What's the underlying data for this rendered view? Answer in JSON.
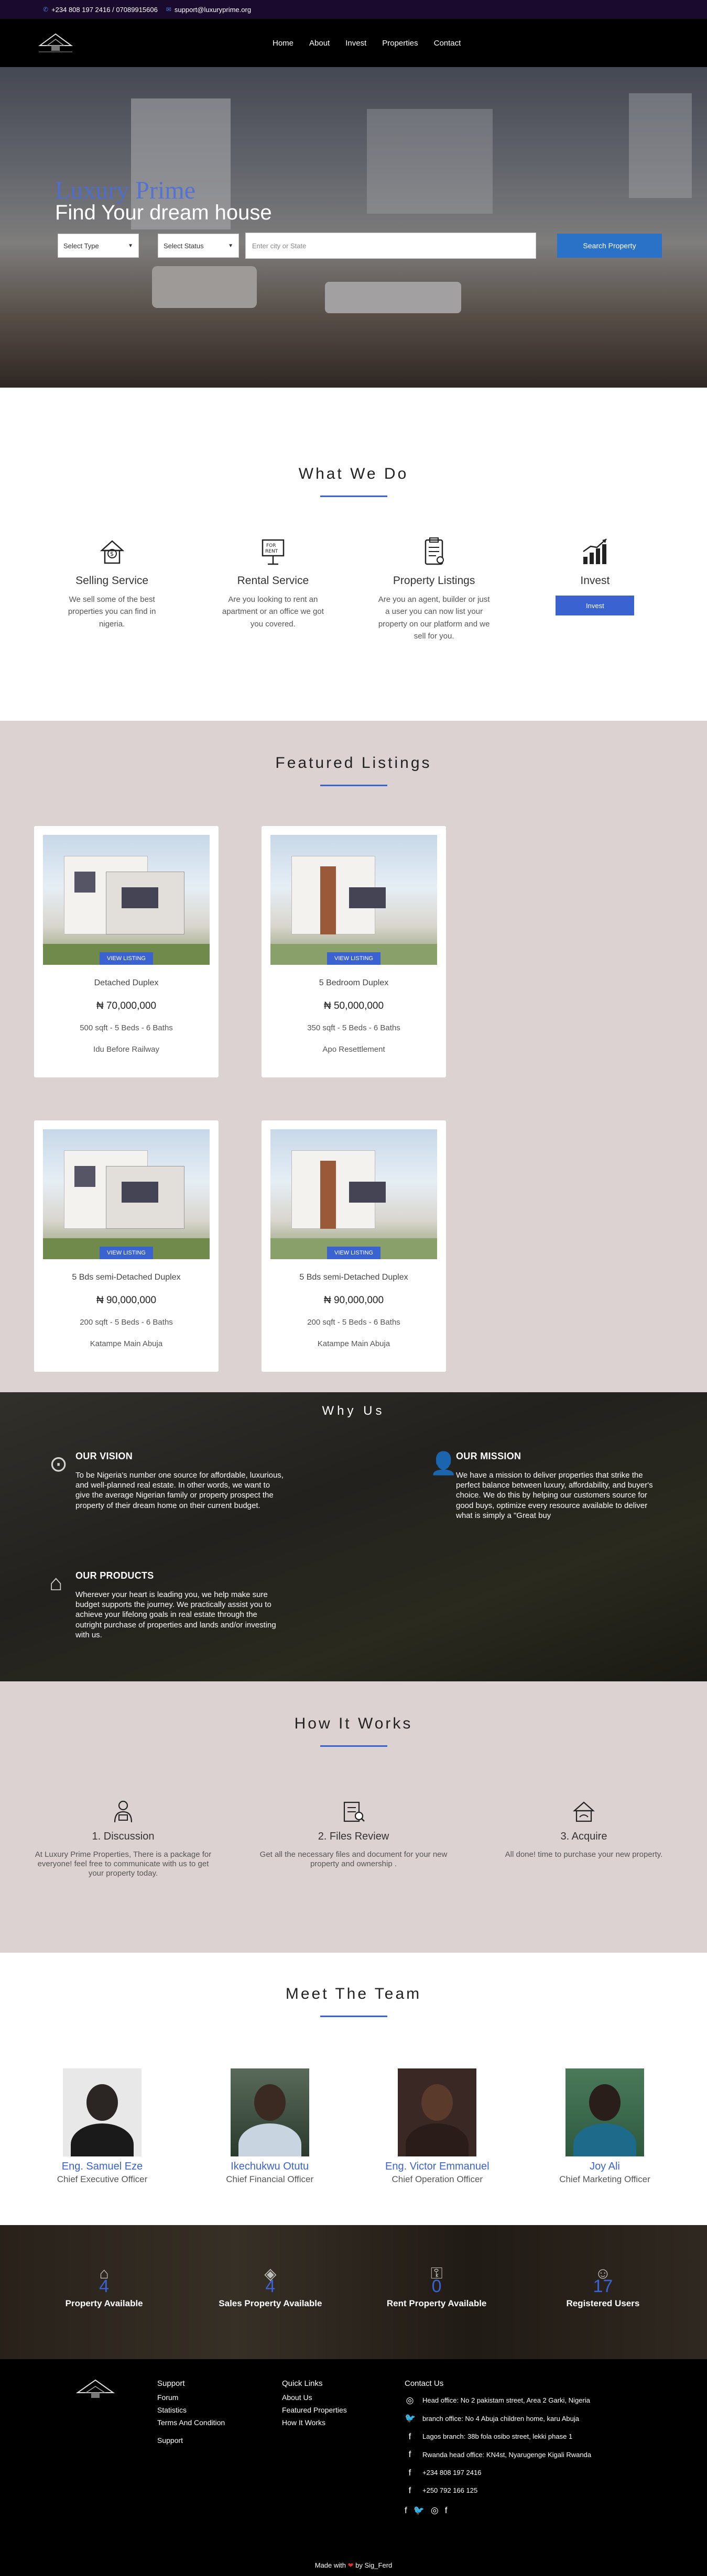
{
  "topbar": {
    "phone": "+234 808 197 2416 / 07089915606",
    "email": "support@luxuryprime.org"
  },
  "nav": {
    "items": [
      "Home",
      "About",
      "Invest",
      "Properties",
      "Contact"
    ]
  },
  "hero": {
    "brand": "Luxury Prime",
    "title": "Find Your dream house",
    "type_select": "Select Type",
    "status_select": "Select Status",
    "city_placeholder": "Enter city or State",
    "search_button": "Search Property"
  },
  "whatwedo": {
    "title": "What We Do",
    "services": [
      {
        "icon": "dollar-house-icon",
        "title": "Selling Service",
        "text": "We sell some of the best properties you can find in nigeria."
      },
      {
        "icon": "for-rent-sign-icon",
        "title": "Rental Service",
        "text": "Are you looking to rent an apartment or an office we got you covered."
      },
      {
        "icon": "clipboard-listing-icon",
        "title": "Property Listings",
        "text": "Are you an agent, builder or just a user you can now list your property on our platform and we sell for you."
      },
      {
        "icon": "growth-chart-icon",
        "title": "Invest",
        "button": "Invest"
      }
    ]
  },
  "featured": {
    "title": "Featured Listings",
    "view_label": "VIEW LISTING",
    "listings": [
      {
        "title": "Detached Duplex",
        "price": "₦ 70,000,000",
        "dims": "500 sqft - 5 Beds - 6 Baths",
        "location": "Idu Before Railway"
      },
      {
        "title": "5 Bedroom Duplex",
        "price": "₦ 50,000,000",
        "dims": "350 sqft - 5 Beds - 6 Baths",
        "location": "Apo Resettlement"
      },
      {
        "title": "5 Bds semi-Detached Duplex",
        "price": "₦ 90,000,000",
        "dims": "200 sqft - 5 Beds - 6 Baths",
        "location": "Katampe Main Abuja"
      },
      {
        "title": "5 Bds semi-Detached Duplex",
        "price": "₦ 90,000,000",
        "dims": "200 sqft - 5 Beds - 6 Baths",
        "location": "Katampe Main Abuja"
      }
    ]
  },
  "whyus": {
    "title": "Why Us",
    "vision": {
      "title": "OUR VISION",
      "text": "To be Nigeria's number one source for affordable, luxurious, and well-planned real estate. In other words, we want to give the average Nigerian family or property prospect the property of their dream home on their current budget."
    },
    "mission": {
      "title": "OUR MISSION",
      "text": "We have a mission to deliver properties that strike the perfect balance between luxury, affordability, and buyer's choice. We do this by helping our customers source for good buys, optimize every resource available to deliver what is simply a \"Great buy"
    },
    "products": {
      "title": "OUR PRODUCTS",
      "text": "Wherever your heart is leading you, we help make sure budget supports the journey. We practically assist you to achieve your lifelong goals in real estate through the outright purchase of properties and lands and/or investing with us."
    }
  },
  "how": {
    "title": "How It Works",
    "steps": [
      {
        "icon": "discussion-icon",
        "title": "1. Discussion",
        "text": "At Luxury Prime Properties, There is a package for everyone! feel free to communicate with us to get your property today."
      },
      {
        "icon": "files-review-icon",
        "title": "2. Files Review",
        "text": "Get all the necessary files and document for your new property and ownership ."
      },
      {
        "icon": "acquire-house-icon",
        "title": "3. Acquire",
        "text": "All done! time to purchase your new property."
      }
    ]
  },
  "team": {
    "title": "Meet The Team",
    "members": [
      {
        "name": "Eng. Samuel Eze",
        "role": "Chief Executive Officer"
      },
      {
        "name": "Ikechukwu Otutu",
        "role": "Chief Financial Officer"
      },
      {
        "name": "Eng. Victor Emmanuel",
        "role": "Chief Operation Officer"
      },
      {
        "name": "Joy Ali",
        "role": "Chief Marketing Officer"
      }
    ]
  },
  "stats": [
    {
      "icon": "house-icon",
      "value": "4",
      "label": "Property Available"
    },
    {
      "icon": "tag-icon",
      "value": "4",
      "label": "Sales Property Available"
    },
    {
      "icon": "key-icon",
      "value": "0",
      "label": "Rent Property Available"
    },
    {
      "icon": "users-icon",
      "value": "17",
      "label": "Registered Users"
    }
  ],
  "footer": {
    "support": {
      "title": "Support",
      "links": [
        "Forum",
        "Statistics",
        "Terms And Condition"
      ],
      "extra": "Support"
    },
    "quick": {
      "title": "Quick Links",
      "links": [
        "About Us",
        "Featured Properties",
        "How It Works"
      ]
    },
    "contact": {
      "title": "Contact Us",
      "rows": [
        {
          "icon": "instagram-icon",
          "text": "Head office: No 2 pakistam street, Area 2 Garki, Nigeria"
        },
        {
          "icon": "twitter-icon",
          "text": "branch office: No 4 Abuja children home, karu Abuja"
        },
        {
          "icon": "facebook-icon",
          "text": "Lagos branch: 38b fola osibo street, lekki phase 1"
        },
        {
          "icon": "facebook-icon",
          "text": "Rwanda head office: KN4st, Nyarugenge Kigali Rwanda"
        },
        {
          "icon": "facebook-icon",
          "text": "+234 808 197 2416"
        },
        {
          "icon": "facebook-icon",
          "text": "+250 792 166 125"
        }
      ]
    },
    "made_with": "Made with",
    "made_by": "by Sig_Ferd"
  }
}
